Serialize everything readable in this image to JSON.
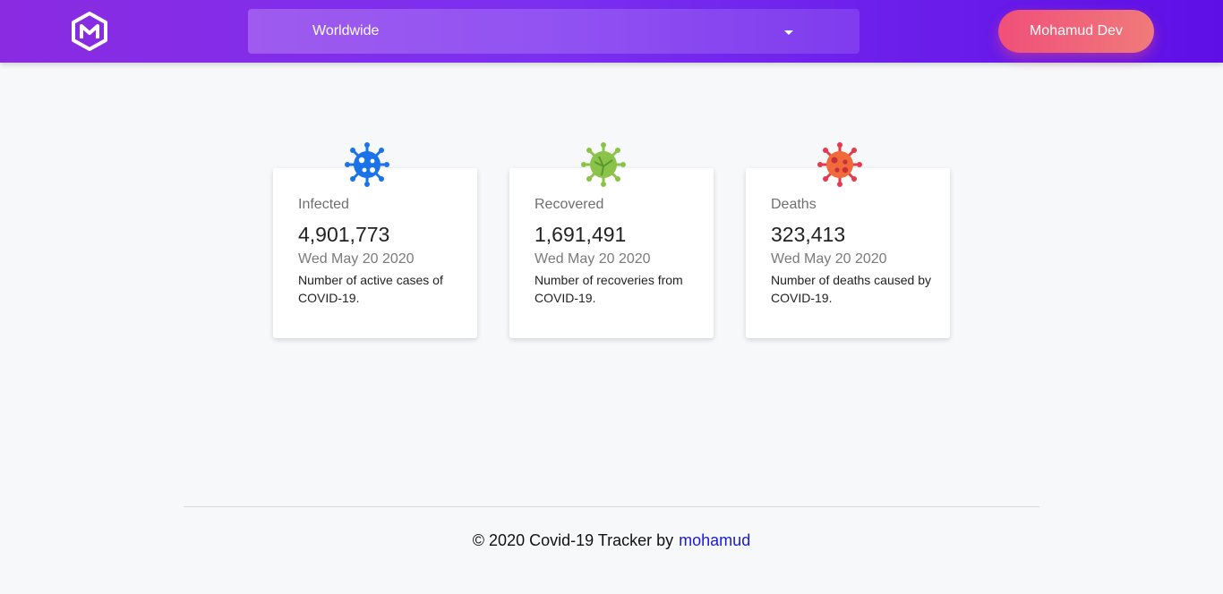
{
  "header": {
    "logo_icon": "hexagon-m-logo",
    "country_select": {
      "value": "Worldwide"
    },
    "user_button_label": "Mohamud Dev"
  },
  "cards": [
    {
      "label": "Infected",
      "value": "4,901,773",
      "date": "Wed May 20 2020",
      "description": "Number of active cases of COVID-19.",
      "icon": "virus-blue-icon",
      "color": "#1a73e8"
    },
    {
      "label": "Recovered",
      "value": "1,691,491",
      "date": "Wed May 20 2020",
      "description": "Number of recoveries from COVID-19.",
      "icon": "virus-green-icon",
      "color": "#8bc34a"
    },
    {
      "label": "Deaths",
      "value": "323,413",
      "date": "Wed May 20 2020",
      "description": "Number of deaths caused by COVID-19.",
      "icon": "virus-red-icon",
      "color": "#e53950"
    }
  ],
  "footer": {
    "text": "© 2020 Covid-19 Tracker by",
    "link_label": "mohamud"
  }
}
